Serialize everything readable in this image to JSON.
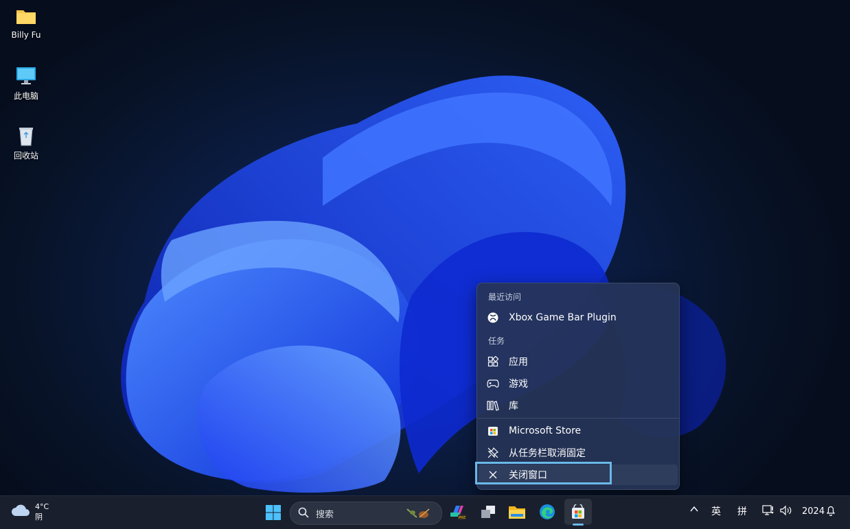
{
  "desktop": {
    "icons": [
      {
        "label": "Billy Fu",
        "icon": "folder-icon"
      },
      {
        "label": "此电脑",
        "icon": "computer-icon"
      },
      {
        "label": "回收站",
        "icon": "recycle-bin-icon"
      }
    ]
  },
  "context_menu": {
    "recent_header": "最近访问",
    "recent_items": [
      {
        "label": "Xbox Game Bar Plugin",
        "icon": "xbox-icon"
      }
    ],
    "tasks_header": "任务",
    "task_items": [
      {
        "label": "应用",
        "icon": "apps-icon"
      },
      {
        "label": "游戏",
        "icon": "gamepad-icon"
      },
      {
        "label": "库",
        "icon": "library-icon"
      }
    ],
    "app_items": [
      {
        "label": "Microsoft Store",
        "icon": "microsoft-store-icon"
      },
      {
        "label": "从任务栏取消固定",
        "icon": "unpin-icon"
      },
      {
        "label": "关闭窗口",
        "icon": "close-icon",
        "focused": true
      }
    ]
  },
  "taskbar": {
    "weather": {
      "temp": "4°C",
      "condition": "阴",
      "icon": "cloud-icon"
    },
    "start_icon": "windows-start-icon",
    "search": {
      "placeholder": "搜索"
    },
    "pinned": [
      "copilot-icon",
      "task-view-icon",
      "file-explorer-icon",
      "edge-icon",
      "microsoft-store-icon"
    ],
    "tray": {
      "chevron": "^",
      "ime_lang": "英",
      "ime_mode": "拼",
      "clock": "2024"
    }
  },
  "colors": {
    "accent": "#6ab8e8",
    "menu_bg": "#263456",
    "taskbar_bg": "#1a202e"
  }
}
